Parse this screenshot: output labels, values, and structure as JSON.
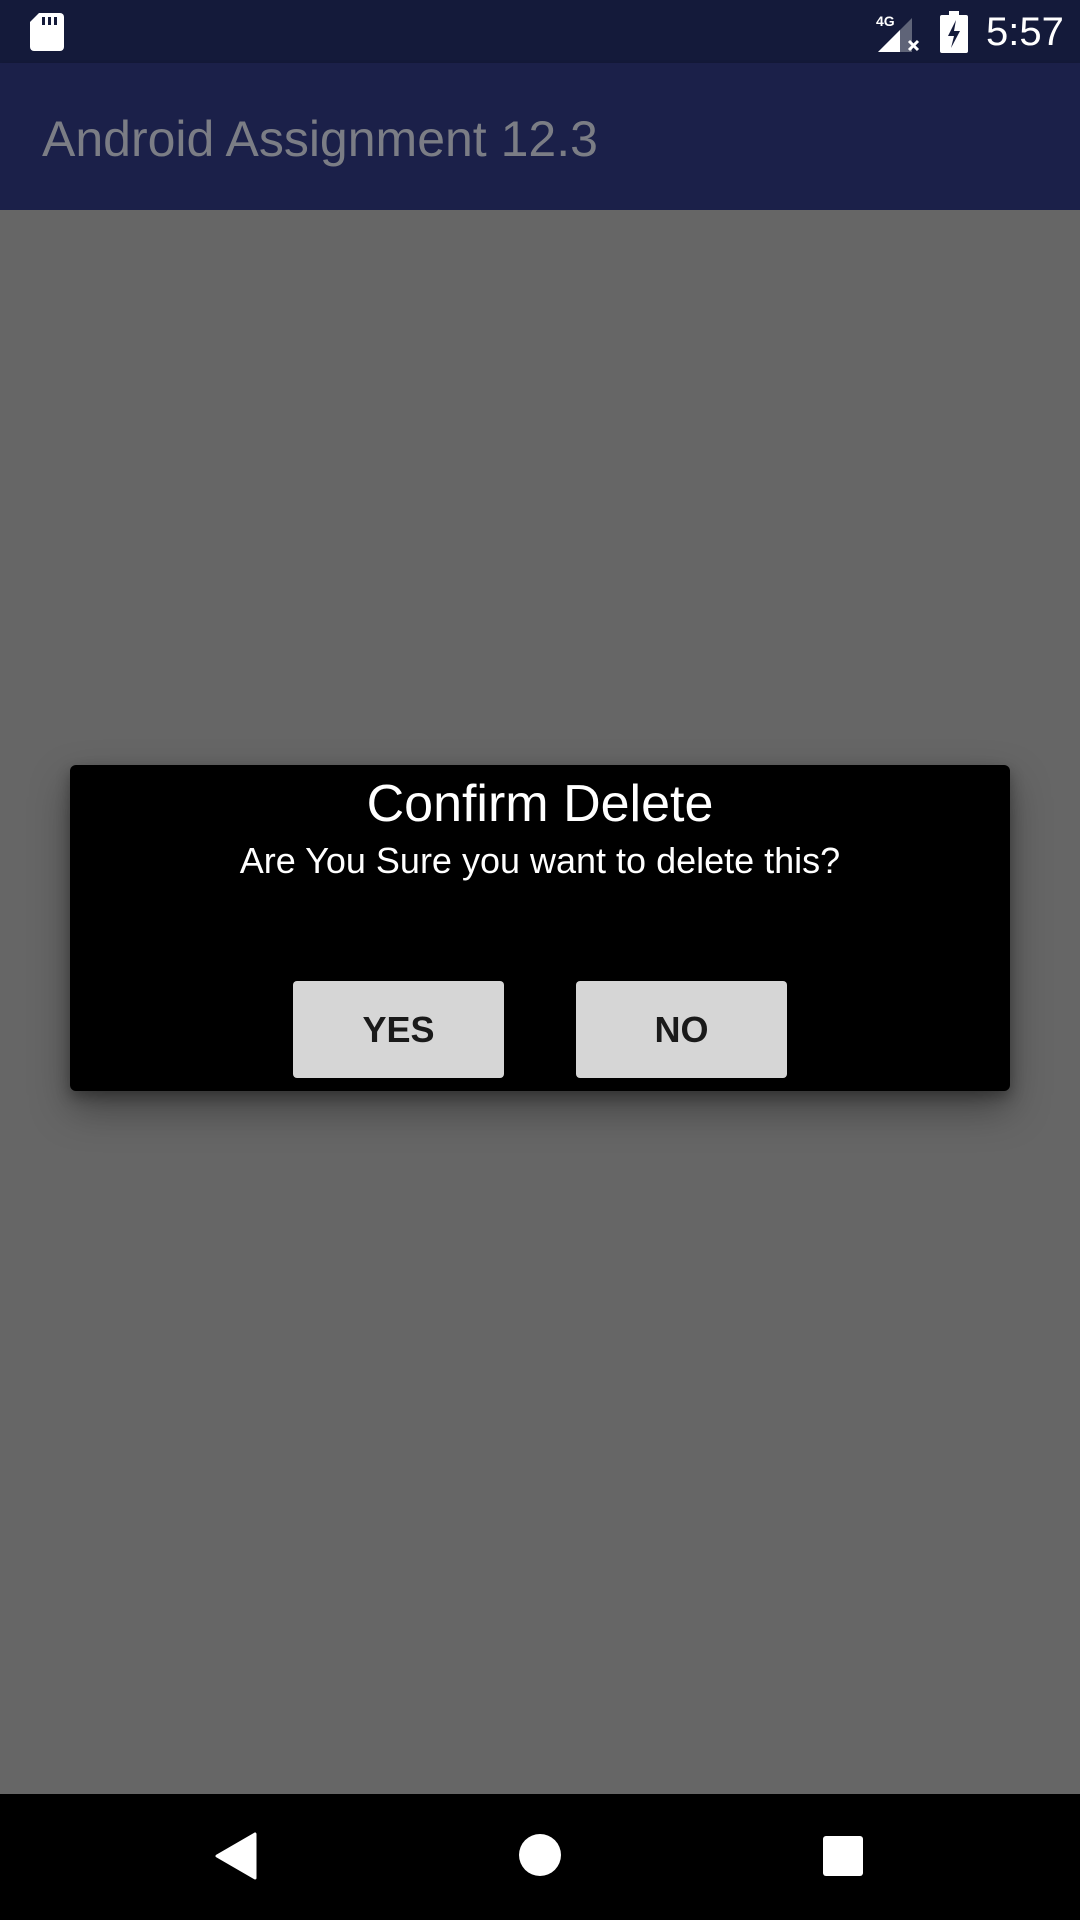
{
  "status_bar": {
    "network_label": "4G",
    "time": "5:57",
    "icons": [
      "sd-card-icon",
      "cellular-signal-icon",
      "battery-charging-icon"
    ]
  },
  "app_bar": {
    "title": "Android Assignment 12.3",
    "color": "#1b2049"
  },
  "dialog": {
    "title": "Confirm Delete",
    "message": "Are You Sure you want to delete this?",
    "yes_label": "YES",
    "no_label": "NO"
  },
  "nav_bar": {
    "icons": [
      "back-icon",
      "home-icon",
      "recents-icon"
    ]
  }
}
